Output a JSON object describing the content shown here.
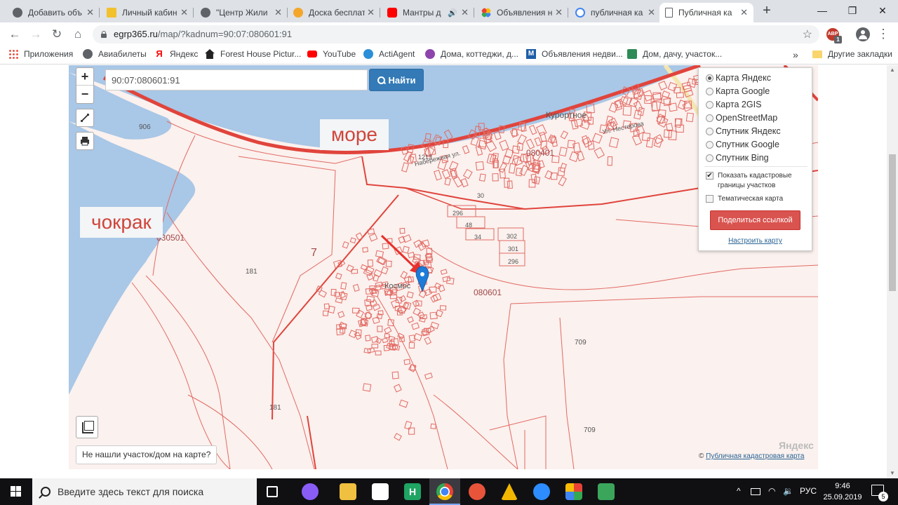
{
  "browser": {
    "tabs": [
      {
        "label": "Добавить объ",
        "color": "#5f6368"
      },
      {
        "label": "Личный кабин",
        "color": "#f2c12e"
      },
      {
        "label": "\"Центр Жили",
        "color": "#5f6368"
      },
      {
        "label": "Доска бесплат",
        "color": "#f4a62a"
      },
      {
        "label": "Мантры д",
        "color": "#ff0000"
      },
      {
        "label": "Объявления н",
        "color": "#34a853"
      },
      {
        "label": "публичная ка",
        "color": "#4285f4"
      },
      {
        "label": "Публичная ка",
        "color": "#5f6368"
      }
    ],
    "new_tab": "+",
    "window_controls": {
      "minimize": "—",
      "maximize": "❐",
      "close": "✕"
    },
    "nav": {
      "back": "←",
      "forward": "→",
      "reload": "↻",
      "home": "⌂"
    },
    "url_host": "egrp365.ru",
    "url_path": "/map/?kadnum=90:07:080601:91",
    "star": "☆",
    "extension_abp": "ABP",
    "extension_badge": "1",
    "menu": "⋮"
  },
  "bookmarks": {
    "apps": "Приложения",
    "items": [
      "Авиабилеты",
      "Яндекс",
      "Forest House Pictur...",
      "YouTube",
      "ActiAgent",
      "Дома, коттеджи, д...",
      "Объявления недви...",
      "Дом, дачу, участок..."
    ],
    "overflow": "»",
    "other": "Другие закладки"
  },
  "map": {
    "search_value": "90:07:080601:91",
    "search_button": "Найти",
    "zoom_in": "+",
    "zoom_out": "−",
    "annotations": {
      "sea": "море",
      "chokrak": "чокрак"
    },
    "labels": {
      "resort": "Курортное",
      "street_nesterova": "Ул. Нестерова",
      "street_nab": "Набережная ул.",
      "cosmos": "Космос",
      "q080401": "080401",
      "q080601": "080601",
      "q030501": "030501",
      "n906": "906",
      "n181a": "181",
      "n181b": "181",
      "n7": "7",
      "n709a": "709",
      "n709b": "709",
      "n1213": "1213",
      "n296a": "296",
      "n48": "48",
      "n34": "34",
      "n302": "302",
      "n301": "301",
      "n296b": "296",
      "n30": "30"
    },
    "layers": [
      "Карта Яндекс",
      "Карта Google",
      "Карта 2GIS",
      "OpenStreetMap",
      "Спутник Яндекс",
      "Спутник Google",
      "Спутник Bing"
    ],
    "selected_layer": "Карта Яндекс",
    "show_cadastral": "Показать кадастровые границы участков",
    "thematic": "Тематическая карта",
    "share_button": "Поделиться ссылкой",
    "config_link": "Настроить карту",
    "report_button": "Не нашли участок/дом на карте?",
    "attribution_prefix": "©",
    "attribution_link": "Публичная кадастровая карта",
    "watermark": "Яндекс",
    "colors": {
      "sea": "#a9c7e6",
      "land": "#fbf1ee",
      "border": "#e0443c",
      "parcel": "#e26a64",
      "pin": "#1e7bd8",
      "arrow": "#e8302b"
    }
  },
  "taskbar": {
    "search_placeholder": "Введите здесь текст для поиска",
    "lang": "РУС",
    "time": "9:46",
    "date": "25.09.2019",
    "notifications": "5"
  }
}
